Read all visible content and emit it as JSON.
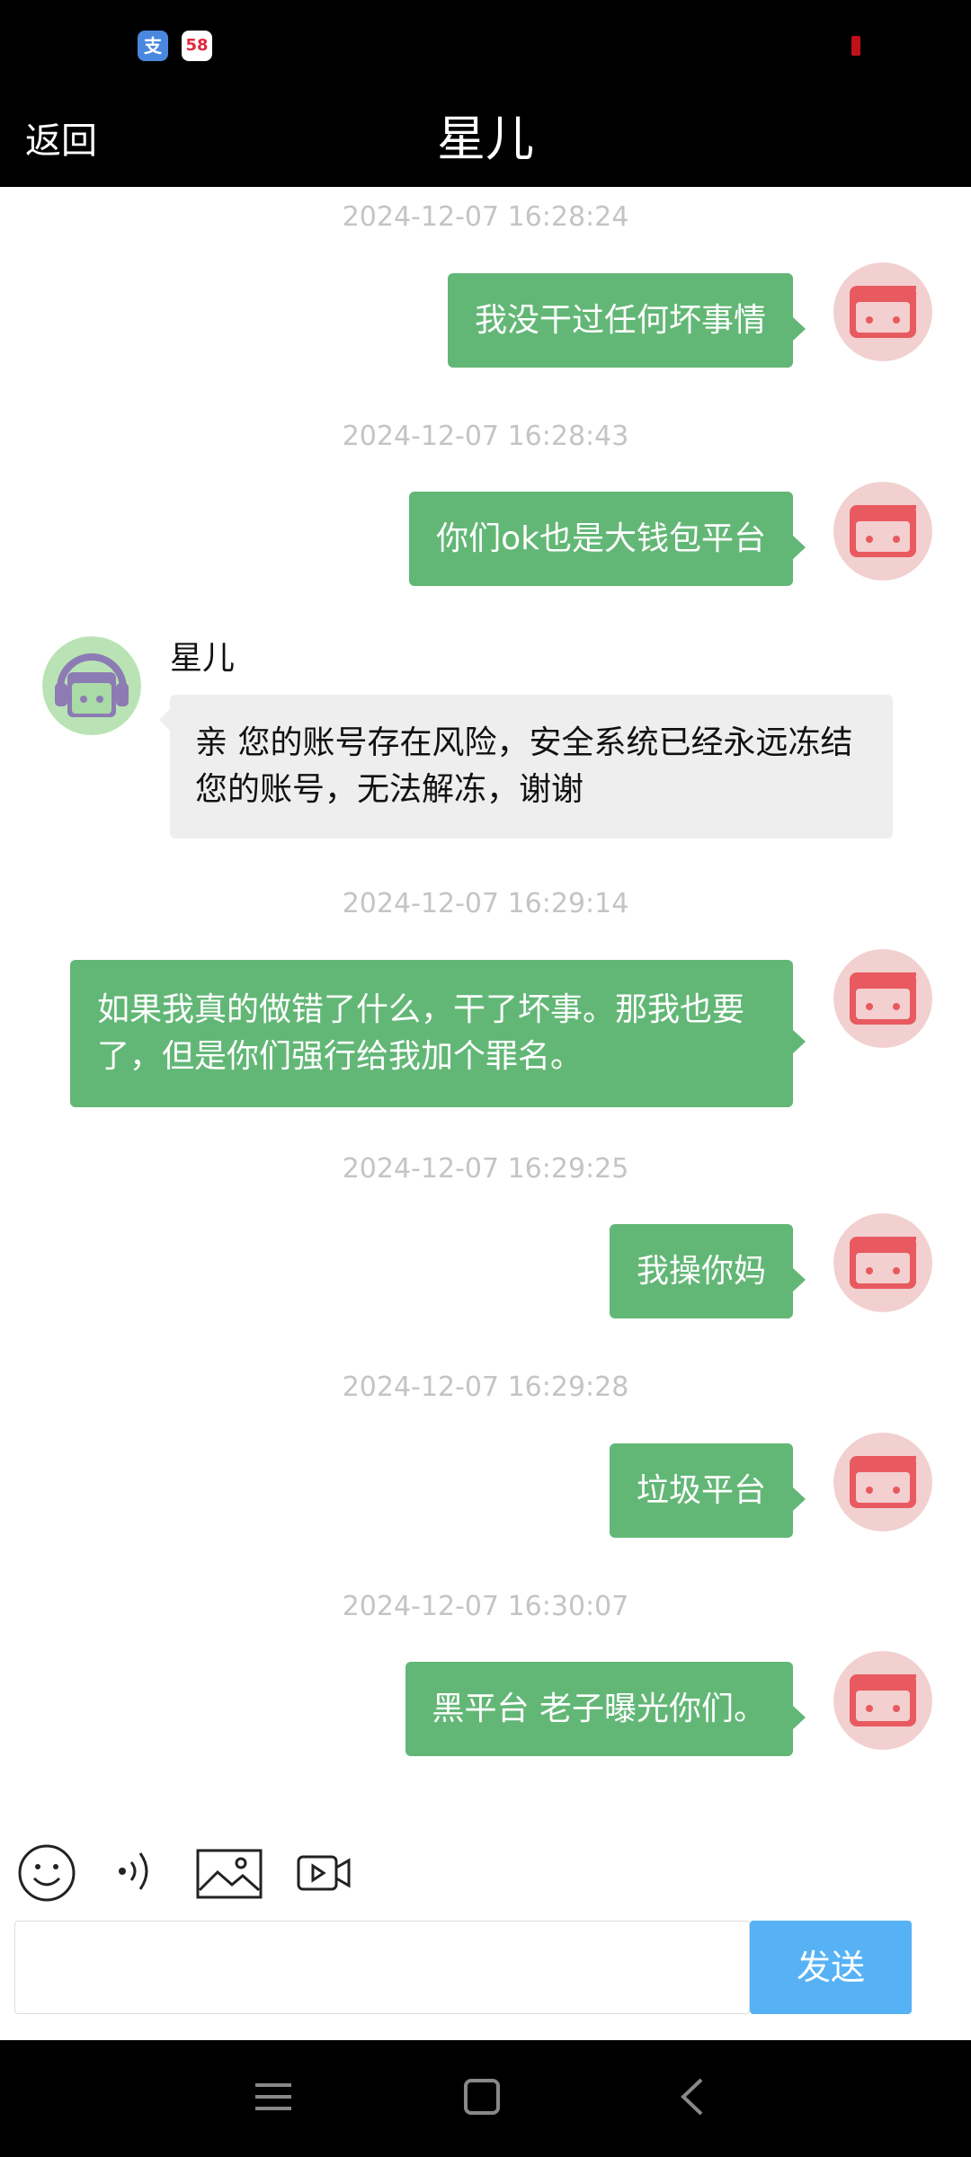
{
  "status_bar": {
    "icons": [
      {
        "name": "alipay-app-icon",
        "glyph": "支"
      },
      {
        "name": "58-app-icon",
        "glyph": "58"
      }
    ]
  },
  "header": {
    "back_label": "返回",
    "title": "星儿"
  },
  "messages": [
    {
      "timestamp": "2024-12-07 16:28:24",
      "text": "我没干过任何坏事情",
      "from": "me"
    },
    {
      "timestamp": "2024-12-07 16:28:43",
      "text": "你们ok也是大钱包平台",
      "from": "me"
    },
    {
      "sender": "星儿",
      "text": "亲 您的账号存在风险，安全系统已经永远冻结您的账号，无法解冻，谢谢",
      "from": "agent"
    },
    {
      "timestamp": "2024-12-07 16:29:14",
      "text": "如果我真的做错了什么，干了坏事。那我也要了，但是你们强行给我加个罪名。",
      "from": "me"
    },
    {
      "timestamp": "2024-12-07 16:29:25",
      "text": "我操你妈",
      "from": "me"
    },
    {
      "timestamp": "2024-12-07 16:29:28",
      "text": "垃圾平台",
      "from": "me"
    },
    {
      "timestamp": "2024-12-07 16:30:07",
      "text": "黑平台 老子曝光你们。",
      "from": "me"
    }
  ],
  "composer": {
    "tools": [
      "emoji-icon",
      "voice-icon",
      "image-icon",
      "video-icon"
    ],
    "input_value": "",
    "send_label": "发送"
  },
  "colors": {
    "outgoing_bubble": "#63b776",
    "incoming_bubble": "#eeeeee",
    "send_button": "#57b2f5",
    "timestamp": "#c4c4c4"
  }
}
